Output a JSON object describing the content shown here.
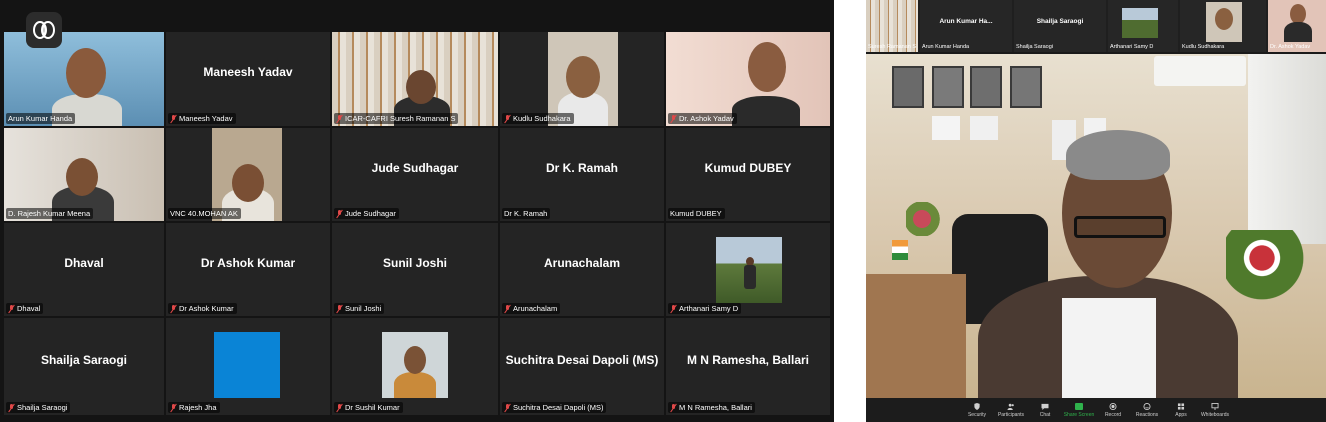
{
  "gallery": {
    "tiles": [
      {
        "name": "",
        "label": "Arun Kumar Handa",
        "muted": false,
        "kind": "video",
        "active": true
      },
      {
        "name": "Maneesh Yadav",
        "label": "Maneesh Yadav",
        "muted": true,
        "kind": "name"
      },
      {
        "name": "",
        "label": "ICAR-CAFRI Suresh Ramanan S",
        "muted": true,
        "kind": "video"
      },
      {
        "name": "",
        "label": "Kudlu Sudhakara",
        "muted": true,
        "kind": "video"
      },
      {
        "name": "",
        "label": "Dr. Ashok Yadav",
        "muted": true,
        "kind": "video"
      },
      {
        "name": "",
        "label": "D. Rajesh Kumar Meena",
        "muted": false,
        "kind": "video"
      },
      {
        "name": "",
        "label": "VNC 40.MOHAN AK",
        "muted": false,
        "kind": "video"
      },
      {
        "name": "Jude Sudhagar",
        "label": "Jude Sudhagar",
        "muted": true,
        "kind": "name"
      },
      {
        "name": "Dr K. Ramah",
        "label": "Dr K. Ramah",
        "muted": false,
        "kind": "name"
      },
      {
        "name": "Kumud DUBEY",
        "label": "Kumud DUBEY",
        "muted": false,
        "kind": "name"
      },
      {
        "name": "Dhaval",
        "label": "Dhaval",
        "muted": true,
        "kind": "name"
      },
      {
        "name": "Dr Ashok Kumar",
        "label": "Dr Ashok Kumar",
        "muted": true,
        "kind": "name"
      },
      {
        "name": "Sunil Joshi",
        "label": "Sunil Joshi",
        "muted": true,
        "kind": "name"
      },
      {
        "name": "Arunachalam",
        "label": "Arunachalam",
        "muted": true,
        "kind": "name"
      },
      {
        "name": "",
        "label": "Arthanari Samy D",
        "muted": true,
        "kind": "photo"
      },
      {
        "name": "Shailja Saraogi",
        "label": "Shailja Saraogi",
        "muted": true,
        "kind": "name"
      },
      {
        "name": "",
        "label": "Rajesh Jha",
        "muted": true,
        "kind": "blue"
      },
      {
        "name": "",
        "label": "Dr Sushil Kumar",
        "muted": true,
        "kind": "photo"
      },
      {
        "name": "Suchitra Desai Dapoli (MS)",
        "label": "Suchitra Desai Dapoli (MS)",
        "muted": true,
        "kind": "name"
      },
      {
        "name": "M N Ramesha, Ballari",
        "label": "M N Ramesha, Ballari",
        "muted": true,
        "kind": "name"
      }
    ]
  },
  "speaker": {
    "strip": [
      {
        "name": "",
        "label": "Suresh Ramanan S"
      },
      {
        "name": "Arun Kumar Ha...",
        "label": "Arun Kumar Handa"
      },
      {
        "name": "Shailja Saraogi",
        "label": "Shailja Saraogi"
      },
      {
        "name": "",
        "label": "Arthanari Samy D"
      },
      {
        "name": "",
        "label": "Kudlu Sudhakara"
      },
      {
        "name": "",
        "label": "Dr. Ashok Yadav"
      }
    ],
    "toolbar": [
      {
        "label": "Security"
      },
      {
        "label": "Participants"
      },
      {
        "label": "Chat"
      },
      {
        "label": "Share Screen"
      },
      {
        "label": "Record"
      },
      {
        "label": "Reactions"
      },
      {
        "label": "Apps"
      },
      {
        "label": "Whiteboards"
      }
    ]
  },
  "colors": {
    "active_border": "#d6e04a",
    "mute_red": "#e04848",
    "share_green": "#2fb24c",
    "tile_bg": "#242424"
  }
}
